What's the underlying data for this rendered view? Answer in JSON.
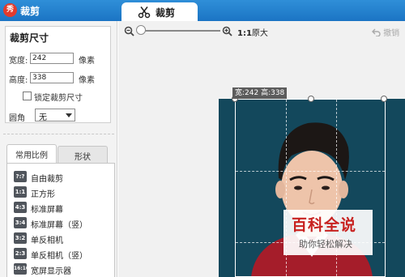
{
  "app": {
    "logo_text": "秀",
    "title": "裁剪"
  },
  "tab": {
    "label": "裁剪",
    "icon": "scissors-icon"
  },
  "size_panel": {
    "title": "裁剪尺寸",
    "width_label": "宽度:",
    "width_value": "242",
    "width_unit": "像素",
    "height_label": "高度:",
    "height_value": "338",
    "height_unit": "像素",
    "lock_label": "锁定裁剪尺寸",
    "lock_checked": false,
    "corner_label": "圆角",
    "corner_value": "无"
  },
  "ratio_tabs": {
    "common": "常用比例",
    "shape": "形状"
  },
  "ratios": [
    {
      "icon": "?:?",
      "label": "自由裁剪"
    },
    {
      "icon": "1:1",
      "label": "正方形"
    },
    {
      "icon": "4:3",
      "label": "标准屏幕"
    },
    {
      "icon": "3:4",
      "label": "标准屏幕（竖）"
    },
    {
      "icon": "3:2",
      "label": "单反相机"
    },
    {
      "icon": "2:3",
      "label": "单反相机（竖）"
    },
    {
      "icon": "16:10",
      "label": "宽屏显示器"
    }
  ],
  "toolbar": {
    "zoom_level": 0,
    "original_ratio": "1:1",
    "original_label": "原大",
    "undo_label": "撤销"
  },
  "canvas": {
    "size_tip": "宽:242 高:338",
    "photo_background": "#13485c"
  },
  "watermark": {
    "main": "百科全说",
    "sub": "助你轻松解决"
  },
  "colors": {
    "titlebar": "#1b74c4",
    "accent_red": "#c8211f"
  }
}
